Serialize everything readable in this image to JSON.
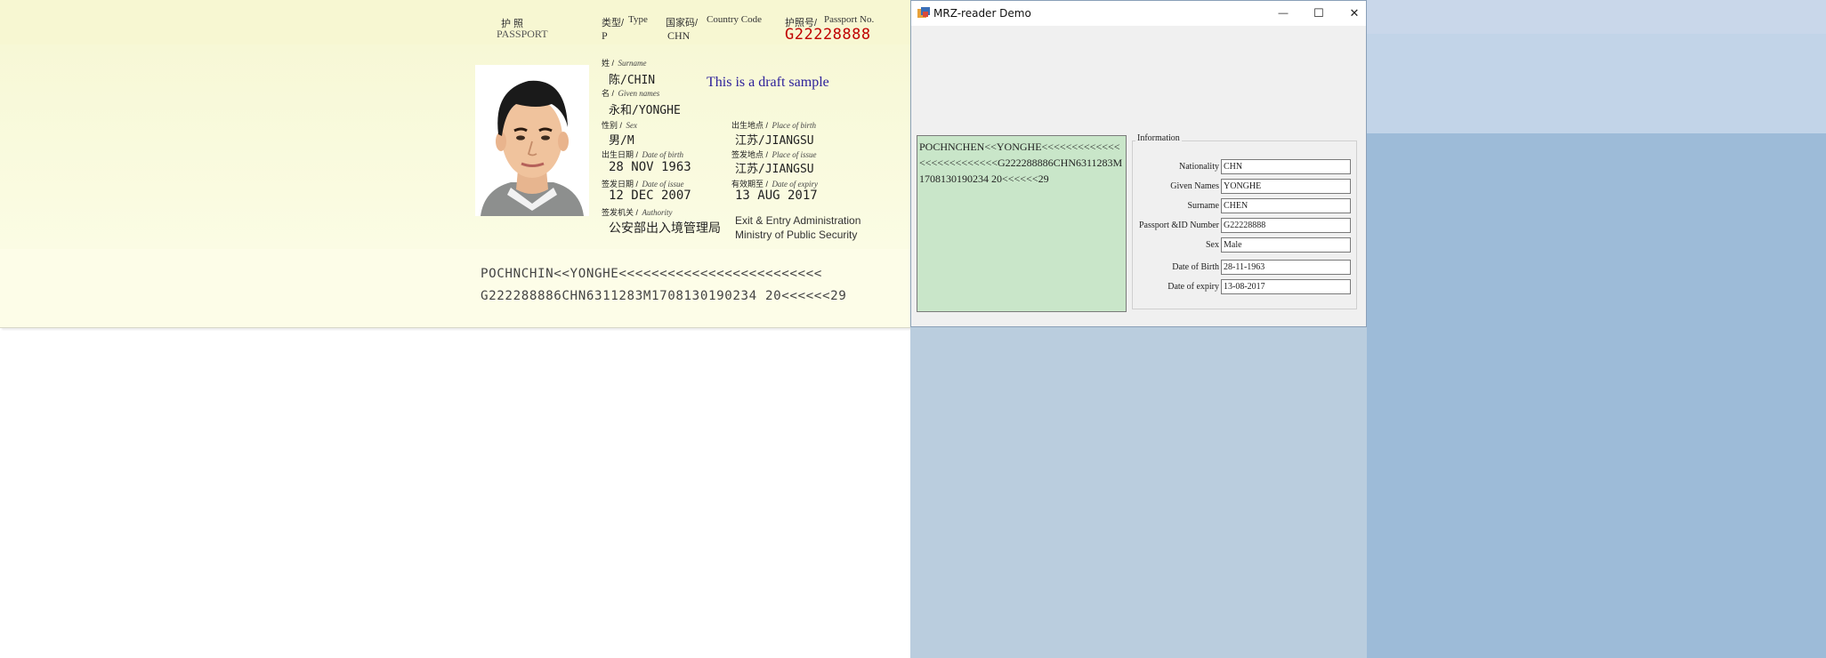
{
  "passport": {
    "title_cn": "护    照",
    "title_en": "PASSPORT",
    "type_label_cn": "类型/",
    "type_label_en": "Type",
    "type_value": "P",
    "country_label_cn": "国家码/",
    "country_label_en": "Country Code",
    "country_value": "CHN",
    "number_label_cn": "护照号/",
    "number_label_en": "Passport No.",
    "number_value": "G22228888",
    "surname_label_cn": "姓 /",
    "surname_label_en": "Surname",
    "surname_value": "陈/CHIN",
    "given_label_cn": "名 /",
    "given_label_en": "Given names",
    "given_value": "永和/YONGHE",
    "draft_note": "This is a draft sample",
    "sex_label_cn": "性别 /",
    "sex_label_en": "Sex",
    "sex_value": "男/M",
    "pob_label_cn": "出生地点 /",
    "pob_label_en": "Place of birth",
    "pob_value": "江苏/JIANGSU",
    "dob_label_cn": "出生日期 /",
    "dob_label_en": "Date of birth",
    "dob_value": "28 NOV 1963",
    "poi_label_cn": "签发地点 /",
    "poi_label_en": "Place of issue",
    "poi_value": "江苏/JIANGSU",
    "doi_label_cn": "签发日期 /",
    "doi_label_en": "Date of issue",
    "doi_value": "12 DEC 2007",
    "doe_label_cn": "有效期至 /",
    "doe_label_en": "Date of expiry",
    "doe_value": "13 AUG 2017",
    "auth_label_cn": "签发机关 /",
    "auth_label_en": "Authority",
    "auth_value_cn": "公安部出入境管理局",
    "auth_value_en_1": "Exit & Entry Administration",
    "auth_value_en_2": "Ministry of Public Security",
    "mrz_line1": "POCHNCHIN<<YONGHE<<<<<<<<<<<<<<<<<<<<<<<<<",
    "mrz_line2": "G222288886CHN6311283M1708130190234 20<<<<<<29"
  },
  "window": {
    "title": "MRZ-reader Demo",
    "minimize_glyph": "—",
    "maximize_glyph": "☐",
    "close_glyph": "✕",
    "mrz_text": "POCHNCHEN<<YONGHE<<<<<<<<<<<<<<<<<<<<<<<<<<G222288886CHN6311283M1708130190234 20<<<<<<29",
    "group_title": "Information",
    "fields": [
      {
        "label": "Nationality",
        "value": "CHN"
      },
      {
        "label": "Given Names",
        "value": "YONGHE"
      },
      {
        "label": "Surname",
        "value": "CHEN"
      },
      {
        "label": "Passport &ID Number",
        "value": "G22228888"
      },
      {
        "label": "Sex",
        "value": "Male"
      },
      {
        "label": "Date of Birth",
        "value": "28-11-1963"
      },
      {
        "label": "Date of expiry",
        "value": "13-08-2017"
      }
    ]
  },
  "colors": {
    "passport_number": "#c00000",
    "draft_note": "#2b1e9a",
    "mrz_box_bg": "#c9e6c9",
    "desktop_left": "#bacdde",
    "desktop_right": "#9dbbd8"
  }
}
